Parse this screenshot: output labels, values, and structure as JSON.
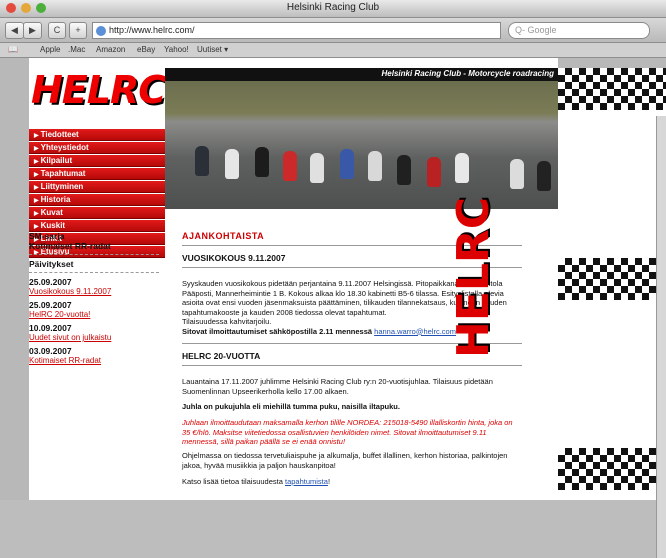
{
  "window": {
    "title": "Helsinki Racing Club"
  },
  "toolbar": {
    "back": "◀",
    "forward": "▶",
    "reload": "C",
    "add": "+",
    "url": "http://www.helrc.com/",
    "search_placeholder": "Q- Google"
  },
  "bookmarks": [
    "Apple",
    ".Mac",
    "Amazon",
    "eBay",
    "Yahoo!",
    "Uutiset ▾"
  ],
  "site": {
    "logo": "HELRC",
    "header_text": "Helsinki Racing Club - Motorcycle roadracing",
    "nav": [
      "Tiedotteet",
      "Yhteystiedot",
      "Kilpailut",
      "Tapahtumat",
      "Liittyminen",
      "Historia",
      "Kuvat",
      "Kuskit",
      "Linkit",
      "Etusivu"
    ],
    "sidebar": {
      "sm_title": "SM-sarja",
      "sm_link": "Kotimaiset RR-radat",
      "updates_title": "Päivitykset",
      "updates": [
        {
          "date": "25.09.2007",
          "link": "Vuosikokous 9.11.2007"
        },
        {
          "date": "25.09.2007",
          "link": "HelRC 20-vuotta!"
        },
        {
          "date": "10.09.2007",
          "link": "Uudet sivut on julkaistu"
        },
        {
          "date": "03.09.2007",
          "link": "Kotimaiset RR-radat"
        }
      ]
    },
    "main": {
      "section_title": "AJANKOHTAISTA",
      "article1_title": "VUOSIKOKOUS 9.11.2007",
      "article1_body": "Syyskauden vuosikokous pidetään perjantaina 9.11.2007 Helsingissä. Pitopaikkana on Ravintola Pääposti, Mannerheimintie 1 B. Kokous alkaa klo 18.30 kabinetti B5-6 tilassa. Esityslistalla olevia asioita ovat ensi vuoden jäsenmaksuista päättäminen, tilikauden tilannekatsaus, kuluneen kauden tapahtumakooste ja kauden 2008 tiedossa olevat tapahtumat.",
      "article1_coffee": "Tilaisuudessa kahvitarjoilu.",
      "article1_signup": "Sitovat ilmoittautumiset sähköpostilla 2.11 mennessä",
      "article1_email": "hanna.warro@helrc.com",
      "article2_title": "HELRC 20-VUOTTA",
      "article2_body1": "Lauantaina 17.11.2007 juhlimme Helsinki Racing Club ry:n 20-vuotisjuhlaa. Tilaisuus pidetään Suomenlinnan Upseerikerholla kello 17.00 alkaen.",
      "article2_dress": "Juhla on pukujuhla eli miehillä tumma puku, naisilla iltapuku.",
      "article2_red": "Juhlaan ilmoittaudutaan maksamalla kerhon tilille NORDEA: 215018-5490 illalliskortin hinta, joka on 35 €/hlö. Maksitse viitetiedossa osallistuvien henkilöiden nimet. Sitovat ilmoittautumiset 9.11 mennessä, sillä paikan päällä se ei enää onnistu!",
      "article2_program": "Ohjelmassa on tiedossa tervetuliaispuhe ja alkumalja, buffet illallinen, kerhon historiaa, palkintojen jakoa, hyvää musiikkia ja paljon hauskanpitoa!",
      "article2_more": "Katso lisää tietoa tilaisuudesta",
      "article2_link": "tapahtumista"
    },
    "banner_text": "HELRC"
  },
  "colors": {
    "accent_red": "#e21a1a",
    "link_blue": "#1f4fb0"
  }
}
